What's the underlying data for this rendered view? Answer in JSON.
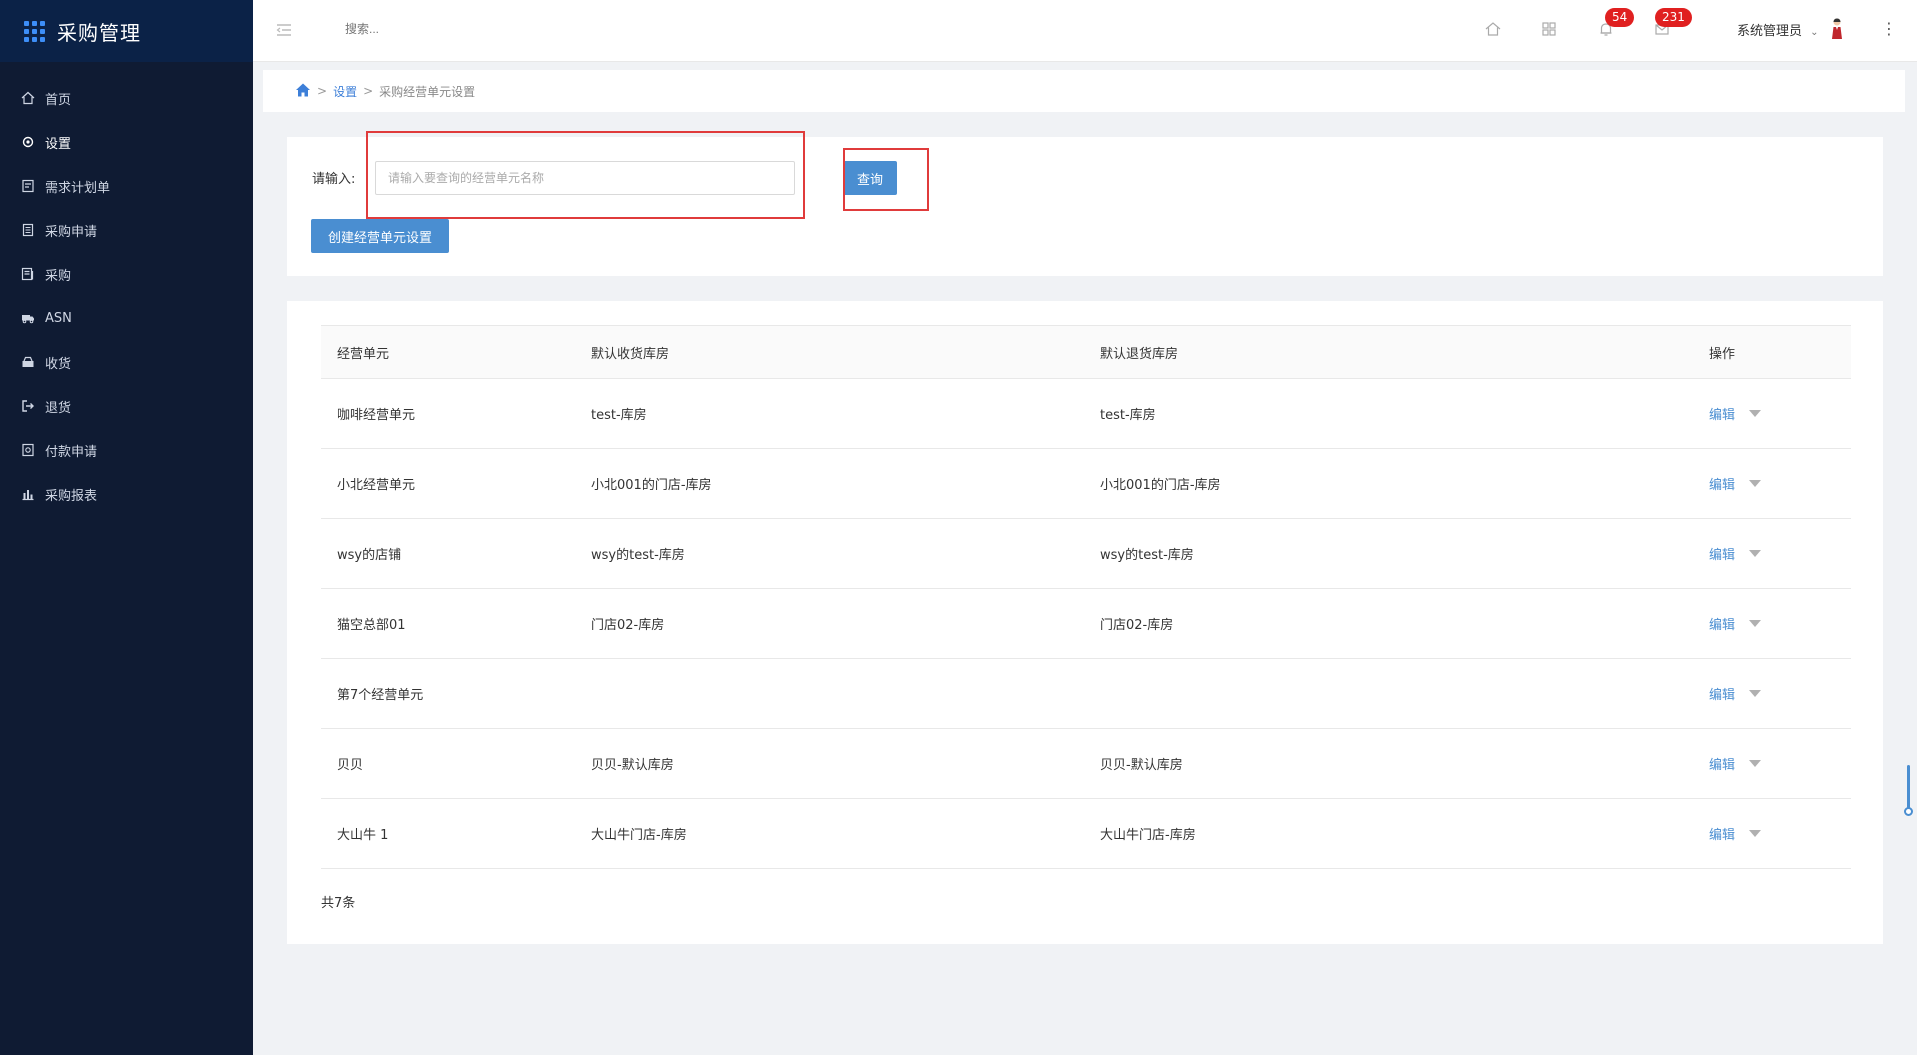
{
  "app": {
    "title": "采购管理"
  },
  "sidebar": {
    "items": [
      {
        "label": "首页",
        "icon": "home-icon"
      },
      {
        "label": "设置",
        "icon": "gear-icon"
      },
      {
        "label": "需求计划单",
        "icon": "document-icon"
      },
      {
        "label": "采购申请",
        "icon": "clipboard-icon"
      },
      {
        "label": "采购",
        "icon": "list-icon"
      },
      {
        "label": "ASN",
        "icon": "truck-icon"
      },
      {
        "label": "收货",
        "icon": "inbox-icon"
      },
      {
        "label": "退货",
        "icon": "return-icon"
      },
      {
        "label": "付款申请",
        "icon": "payment-icon"
      },
      {
        "label": "采购报表",
        "icon": "bar-chart-icon"
      }
    ],
    "active_index": 1
  },
  "header": {
    "search_placeholder": "搜索...",
    "notifications_count": "54",
    "messages_count": "231",
    "user_name": "系统管理员"
  },
  "breadcrumb": {
    "items": [
      "设置",
      "采购经营单元设置"
    ]
  },
  "filter": {
    "label": "请输入:",
    "placeholder": "请输入要查询的经营单元名称",
    "value": "",
    "query_button": "查询",
    "create_button": "创建经营单元设置"
  },
  "table": {
    "columns": [
      "经营单元",
      "默认收货库房",
      "默认退货库房",
      "操作"
    ],
    "rows": [
      [
        "咖啡经营单元",
        "test-库房",
        "test-库房"
      ],
      [
        "小北经营单元",
        "小北001的门店-库房",
        "小北001的门店-库房"
      ],
      [
        "wsy的店铺",
        "wsy的test-库房",
        "wsy的test-库房"
      ],
      [
        "猫空总部01",
        "门店02-库房",
        "门店02-库房"
      ],
      [
        "第7个经营单元",
        "",
        ""
      ],
      [
        "贝贝",
        "贝贝-默认库房",
        "贝贝-默认库房"
      ],
      [
        "大山牛 1",
        "大山牛门店-库房",
        "大山牛门店-库房"
      ]
    ],
    "edit_label": "编辑",
    "total_text": "共7条"
  },
  "colors": {
    "sidebar_bg": "#0f1b33",
    "accent": "#4a8ed1",
    "highlight_border": "#e03b3b",
    "badge": "#e02020"
  }
}
